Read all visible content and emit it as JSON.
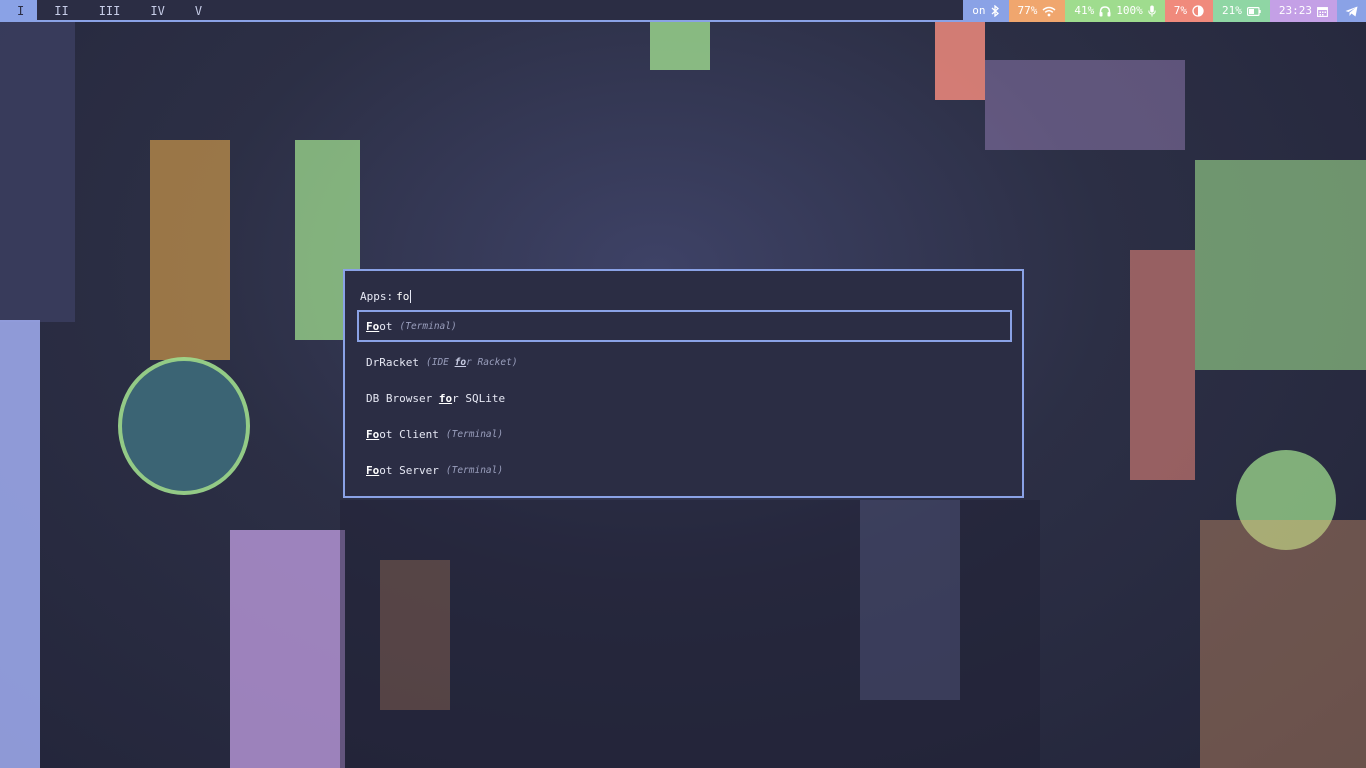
{
  "topbar": {
    "workspaces": [
      {
        "label": "I",
        "active": true
      },
      {
        "label": "II",
        "active": false
      },
      {
        "label": "III",
        "active": false
      },
      {
        "label": "IV",
        "active": false
      },
      {
        "label": "V",
        "active": false
      }
    ],
    "modules": {
      "bluetooth": {
        "text": "on",
        "icon": "bluetooth-icon",
        "color": "#8aa2e6"
      },
      "wifi": {
        "text": "77%",
        "icon": "wifi-icon",
        "color": "#f0a66e"
      },
      "audio": {
        "text": "41%",
        "icon": "headphones-icon",
        "color": "#9fdc8e"
      },
      "microphone": {
        "text": "100%",
        "icon": "microphone-icon",
        "color": "#9fdc8e"
      },
      "brightness": {
        "text": "7%",
        "icon": "brightness-icon",
        "color": "#f08a7c"
      },
      "battery": {
        "text": "21%",
        "icon": "battery-icon",
        "color": "#8fd6a4"
      },
      "clock": {
        "text": "23:23",
        "icon": "calendar-icon",
        "color": "#c4a0e6"
      },
      "tray": {
        "icon": "telegram-icon",
        "color": "#8aa2e6"
      }
    }
  },
  "launcher": {
    "prompt": "Apps:",
    "query": "fo",
    "results": [
      {
        "before": "",
        "match": "Fo",
        "after": "ot",
        "comment": {
          "before": "Terminal",
          "match": "",
          "after": ""
        },
        "selected": true
      },
      {
        "before": "DrRacket",
        "match": "",
        "after": "",
        "comment": {
          "before": "IDE ",
          "match": "fo",
          "after": "r Racket"
        },
        "selected": false
      },
      {
        "before": "DB Browser ",
        "match": "fo",
        "after": "r SQLite",
        "comment": null,
        "selected": false
      },
      {
        "before": "",
        "match": "Fo",
        "after": "ot Client",
        "comment": {
          "before": "Terminal",
          "match": "",
          "after": ""
        },
        "selected": false
      },
      {
        "before": "",
        "match": "Fo",
        "after": "ot Server",
        "comment": {
          "before": "Terminal",
          "match": "",
          "after": ""
        },
        "selected": false
      }
    ]
  },
  "colors": {
    "bar_bg": "#2b2d44",
    "accent": "#8aa2e6",
    "text": "#e6e8f4"
  }
}
